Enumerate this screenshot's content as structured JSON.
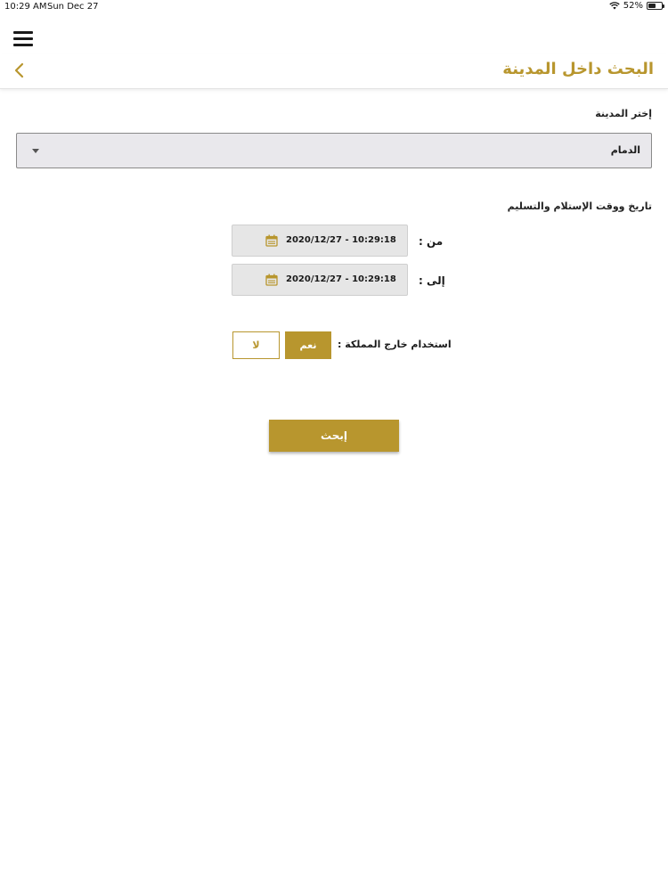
{
  "status_bar": {
    "time": "10:29 AM",
    "date": "Sun Dec 27",
    "battery": "52%"
  },
  "header": {
    "title": "البحث داخل المدينة"
  },
  "form": {
    "city_label": "إختر المدينة",
    "city_value": "الدمام",
    "datetime_label": "تاريخ ووقت الإستلام والتسليم",
    "from_label": "من :",
    "from_value": "2020/12/27 - 10:29:18",
    "to_label": "إلى :",
    "to_value": "2020/12/27 - 10:29:18",
    "abroad_label": "استخدام خارج المملكة :",
    "yes_label": "نعم",
    "no_label": "لا",
    "search_label": "إبحث"
  },
  "colors": {
    "accent": "#b8962e",
    "field_bg": "#e9e8ec"
  }
}
